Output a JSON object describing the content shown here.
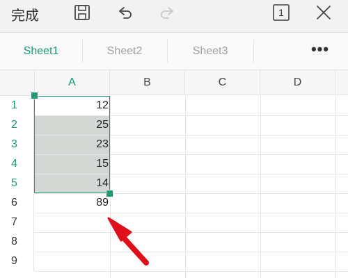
{
  "toolbar": {
    "done_label": "完成",
    "page_number": "1",
    "icons": [
      "save-icon",
      "undo-icon",
      "redo-icon",
      "page-icon",
      "close-icon"
    ]
  },
  "tabs": {
    "items": [
      {
        "label": "Sheet1",
        "active": true
      },
      {
        "label": "Sheet2",
        "active": false
      },
      {
        "label": "Sheet3",
        "active": false
      }
    ],
    "more_label": "•••"
  },
  "grid": {
    "columns": [
      "A",
      "B",
      "C",
      "D"
    ],
    "rows": [
      "1",
      "2",
      "3",
      "4",
      "5",
      "6",
      "7",
      "8",
      "9"
    ],
    "cells_a": [
      "12",
      "25",
      "23",
      "15",
      "14",
      "89"
    ],
    "selection": "A1:A5",
    "colors": {
      "accent": "#1a9c70",
      "selection_fill": "#d3d8d4",
      "arrow": "#e0101a"
    }
  }
}
